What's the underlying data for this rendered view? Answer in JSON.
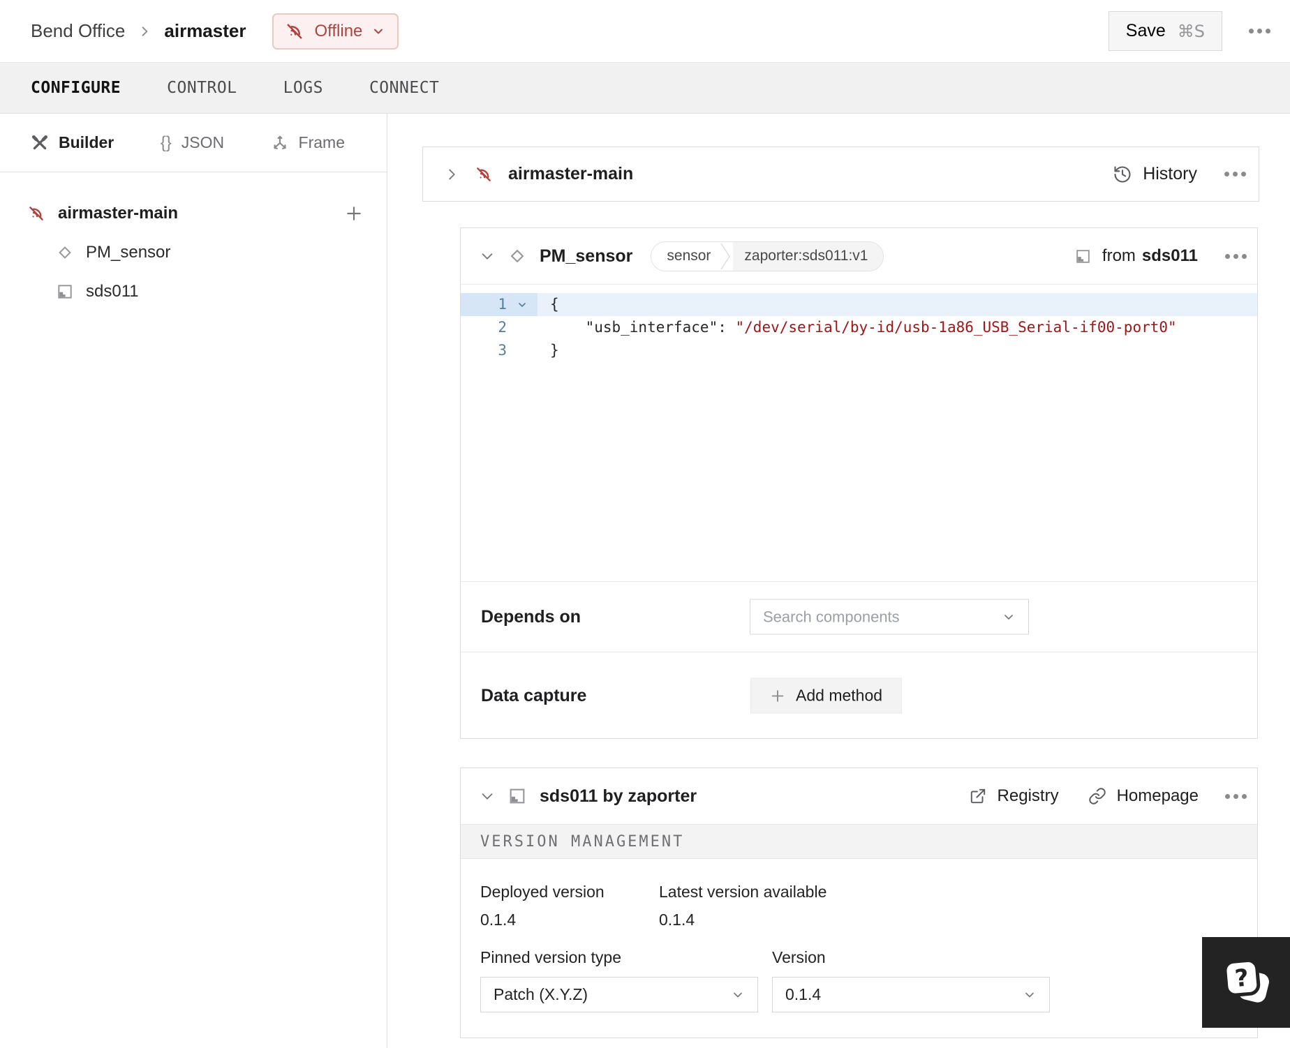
{
  "header": {
    "breadcrumb": {
      "org": "Bend Office",
      "machine": "airmaster"
    },
    "status_label": "Offline",
    "save_label": "Save",
    "save_shortcut": "⌘S"
  },
  "tabs": [
    {
      "label": "CONFIGURE",
      "active": true
    },
    {
      "label": "CONTROL",
      "active": false
    },
    {
      "label": "LOGS",
      "active": false
    },
    {
      "label": "CONNECT",
      "active": false
    }
  ],
  "sidebar": {
    "views": [
      {
        "label": "Builder",
        "active": true
      },
      {
        "label": "JSON",
        "active": false
      },
      {
        "label": "Frame",
        "active": false
      }
    ],
    "tree": {
      "root_label": "airmaster-main",
      "children": [
        {
          "label": "PM_sensor",
          "type": "component"
        },
        {
          "label": "sds011",
          "type": "module"
        }
      ]
    }
  },
  "main": {
    "part_card": {
      "title": "airmaster-main",
      "history_label": "History"
    },
    "pm_card": {
      "title": "PM_sensor",
      "type_badge": "sensor",
      "model_badge": "zaporter:sds011:v1",
      "from_prefix": "from",
      "from_target": "sds011",
      "code": {
        "line_numbers": [
          "1",
          "2",
          "3"
        ],
        "line1": "{",
        "line2_key": "    \"usb_interface\"",
        "line2_sep": ": ",
        "line2_value": "\"/dev/serial/by-id/usb-1a86_USB_Serial-if00-port0\"",
        "line3": "}"
      },
      "depends_label": "Depends on",
      "depends_placeholder": "Search components",
      "capture_label": "Data capture",
      "capture_button": "Add method"
    },
    "module_card": {
      "title": "sds011 by zaporter",
      "registry_label": "Registry",
      "homepage_label": "Homepage",
      "section_title": "VERSION MANAGEMENT",
      "deployed_label": "Deployed version",
      "deployed_value": "0.1.4",
      "latest_label": "Latest version available",
      "latest_value": "0.1.4",
      "pinned_label": "Pinned version type",
      "pinned_value": "Patch (X.Y.Z)",
      "version_label": "Version",
      "version_value": "0.1.4"
    }
  },
  "icons": {
    "status": "wifi-off",
    "builder": "hammer-wrench",
    "json": "curly-braces",
    "frame": "axes",
    "component": "diamond",
    "module": "module-square",
    "history": "clock-restore",
    "registry": "external-link",
    "homepage": "chain-link",
    "overflow": "ellipsis",
    "help": "question-card"
  },
  "colors": {
    "offline_red": "#ae443f",
    "offline_bg": "#fcf1f0",
    "code_string_red": "#a31515",
    "active_line_blue": "#e9f1fb",
    "gutter_blue": "#54809f",
    "tabbar_bg": "#f1f1f2",
    "card_border": "#dcdcde",
    "help_bg": "#232324"
  }
}
